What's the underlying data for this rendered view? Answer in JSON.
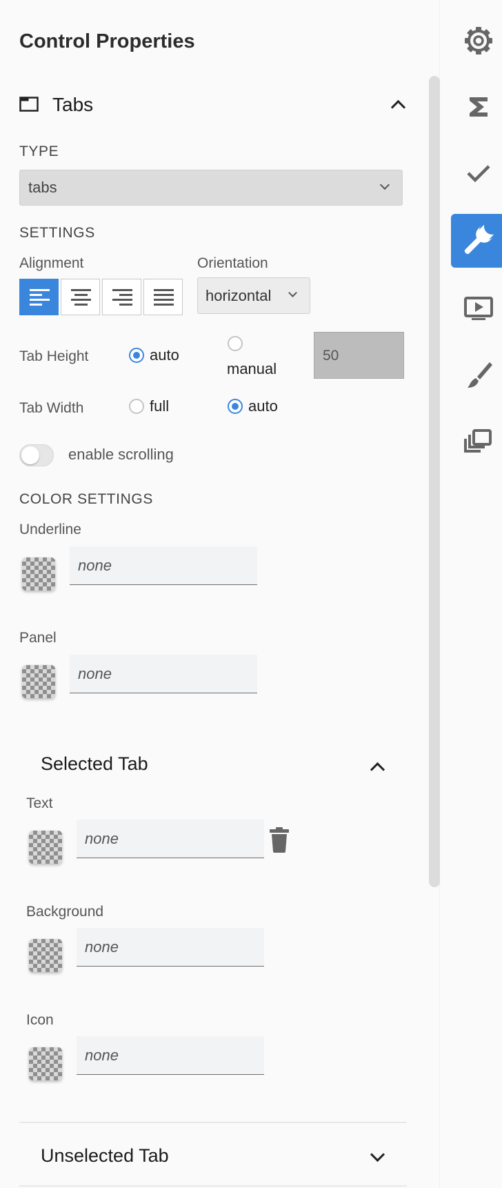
{
  "panel_title": "Control Properties",
  "section": {
    "title": "Tabs",
    "icon": "tab-window-icon"
  },
  "type": {
    "heading": "TYPE",
    "value": "tabs"
  },
  "settings": {
    "heading": "SETTINGS",
    "alignment_label": "Alignment",
    "alignment_options": [
      "left",
      "center",
      "right",
      "justify"
    ],
    "alignment_selected": "left",
    "orientation_label": "Orientation",
    "orientation_value": "horizontal",
    "tab_height": {
      "label": "Tab Height",
      "auto": "auto",
      "manual": "manual",
      "selected": "auto",
      "manual_value": "50"
    },
    "tab_width": {
      "label": "Tab Width",
      "full": "full",
      "auto": "auto",
      "selected": "auto"
    },
    "scrolling": {
      "label": "enable scrolling",
      "enabled": false
    }
  },
  "color_settings": {
    "heading": "COLOR SETTINGS",
    "underline": {
      "label": "Underline",
      "value": "none"
    },
    "panel": {
      "label": "Panel",
      "value": "none"
    }
  },
  "selected_tab": {
    "title": "Selected Tab",
    "text": {
      "label": "Text",
      "value": "none"
    },
    "background": {
      "label": "Background",
      "value": "none"
    },
    "icon": {
      "label": "Icon",
      "value": "none"
    }
  },
  "unselected_tab": {
    "title": "Unselected Tab"
  },
  "rail": {
    "items": [
      {
        "name": "settings",
        "icon": "gear-icon"
      },
      {
        "name": "formula",
        "icon": "sigma-icon"
      },
      {
        "name": "validation",
        "icon": "checkmark-icon"
      },
      {
        "name": "properties",
        "icon": "wrench-icon",
        "active": true
      },
      {
        "name": "preview",
        "icon": "play-screen-icon"
      },
      {
        "name": "style",
        "icon": "brush-icon"
      },
      {
        "name": "layers",
        "icon": "layers-icon"
      }
    ]
  },
  "colors": {
    "accent": "#3b86dd",
    "disabled_field": "#bcbcbc",
    "select_bg": "#dcdcdc"
  }
}
